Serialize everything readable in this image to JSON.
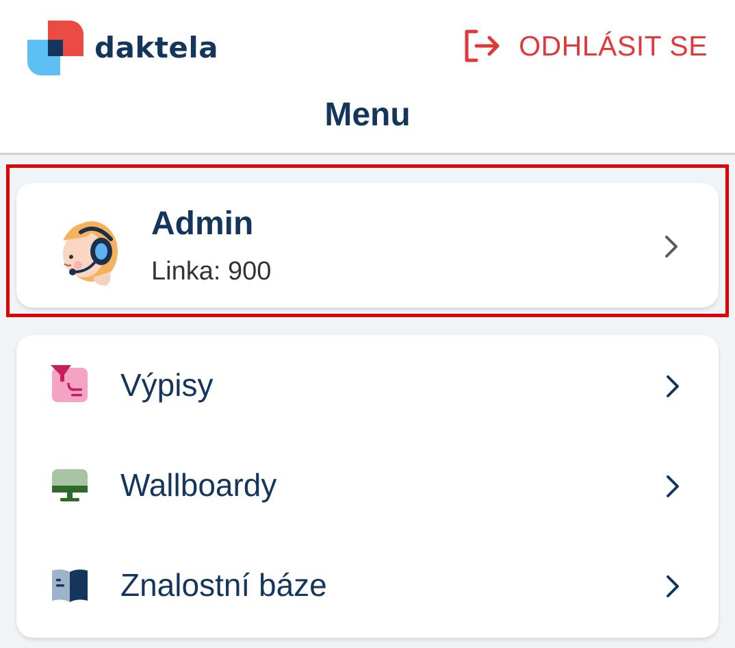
{
  "header": {
    "brand": "daktela",
    "logout_label": "ODHLÁSIT SE",
    "title": "Menu"
  },
  "profile": {
    "name": "Admin",
    "line": "Linka: 900"
  },
  "menu": {
    "items": [
      {
        "label": "Výpisy",
        "icon": "reports-icon"
      },
      {
        "label": "Wallboardy",
        "icon": "monitor-icon"
      },
      {
        "label": "Znalostní báze",
        "icon": "book-icon"
      }
    ]
  },
  "colors": {
    "brand_navy": "#14355c",
    "logout_red": "#e0393b",
    "highlight_red": "#e00000",
    "background": "#f1f4f7"
  }
}
